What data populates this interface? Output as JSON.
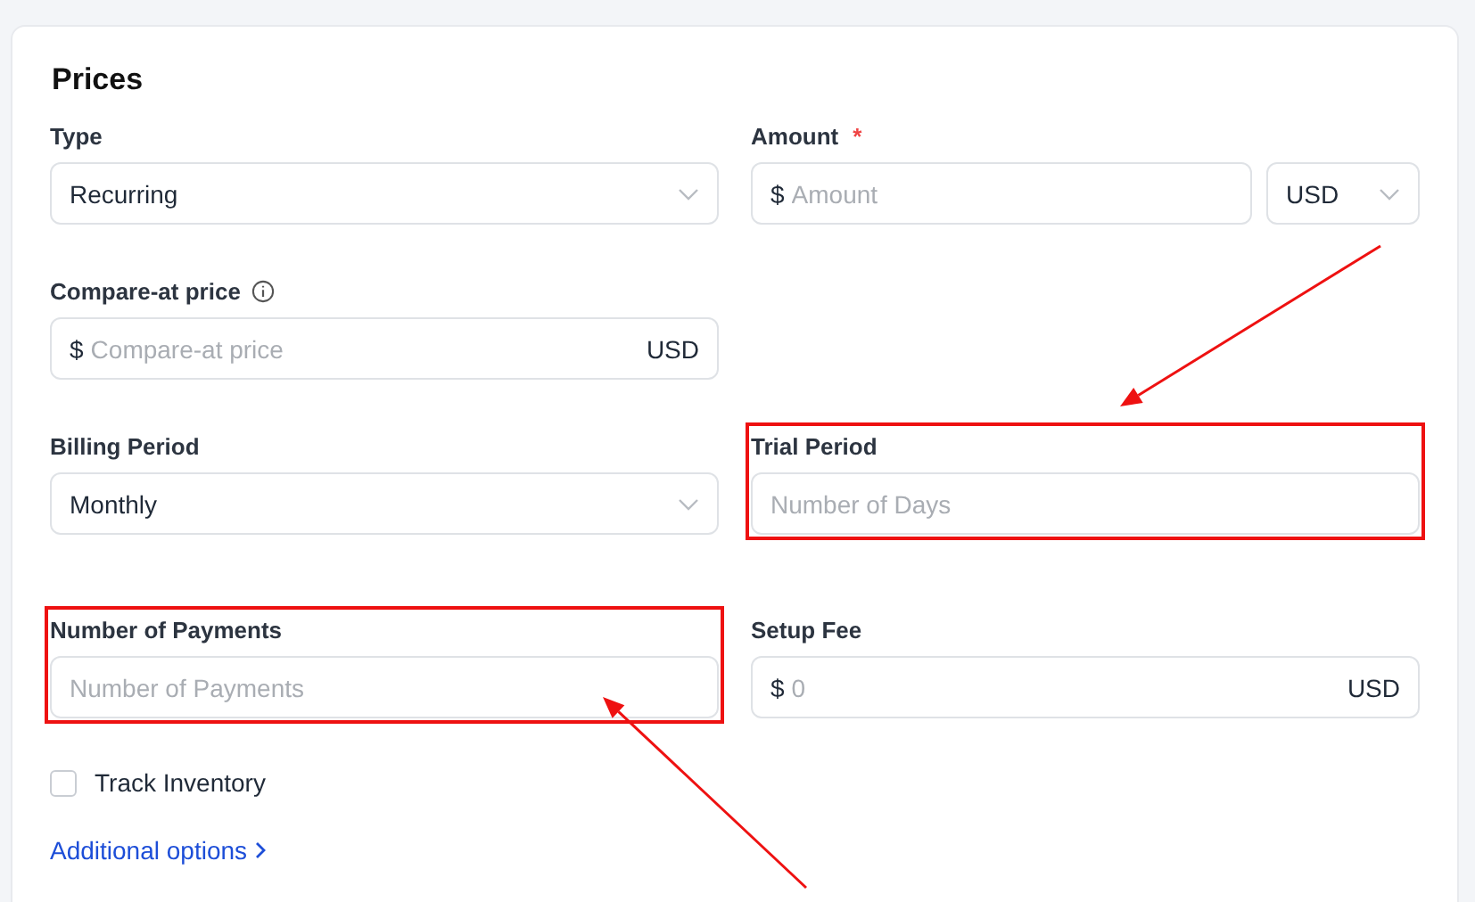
{
  "card": {
    "title": "Prices"
  },
  "rows": [
    [
      {
        "kind": "select",
        "label": "Type",
        "value": "Recurring",
        "highlighted": false
      },
      {
        "kind": "amount",
        "label": "Amount",
        "required_mark": "*",
        "prefix": "$",
        "placeholder": "Amount",
        "currency": "USD",
        "highlighted": false
      }
    ],
    [
      {
        "kind": "money",
        "label": "Compare-at price",
        "info": true,
        "prefix": "$",
        "placeholder": "Compare-at price",
        "suffix": "USD",
        "highlighted": false
      }
    ],
    [
      {
        "kind": "select",
        "label": "Billing Period",
        "value": "Monthly",
        "highlighted": false
      },
      {
        "kind": "text",
        "label": "Trial Period",
        "placeholder": "Number of Days",
        "highlighted": true
      }
    ],
    [
      {
        "kind": "text",
        "label": "Number of Payments",
        "placeholder": "Number of Payments",
        "highlighted": true
      },
      {
        "kind": "money",
        "label": "Setup Fee",
        "prefix": "$",
        "placeholder": "0",
        "suffix": "USD",
        "highlighted": false
      }
    ]
  ],
  "checkbox": {
    "label": "Track Inventory",
    "checked": false
  },
  "link": {
    "label": "Additional options"
  }
}
